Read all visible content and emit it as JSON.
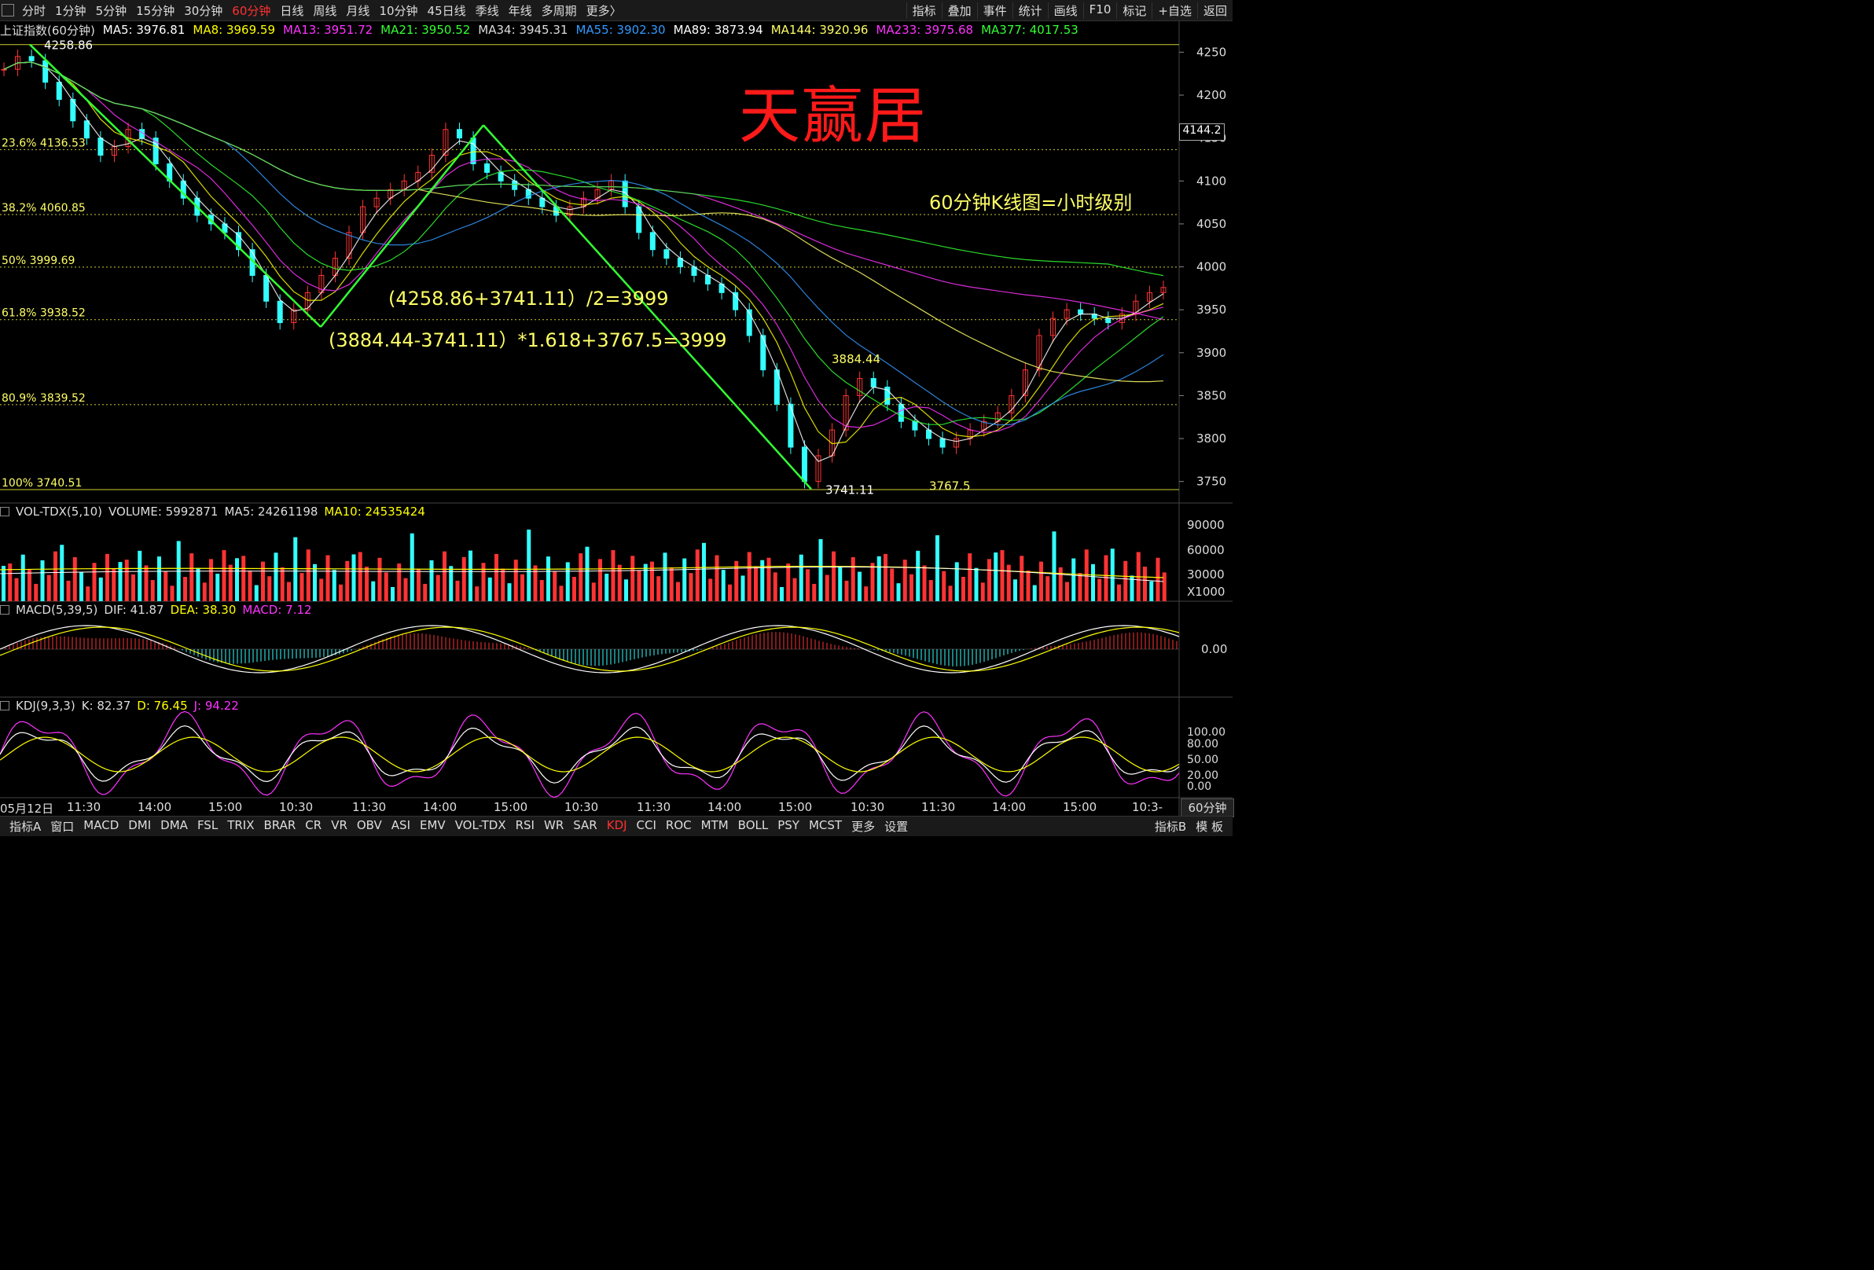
{
  "top_tabs": [
    "分时",
    "1分钟",
    "5分钟",
    "15分钟",
    "30分钟",
    "60分钟",
    "日线",
    "周线",
    "月线",
    "10分钟",
    "45日线",
    "季线",
    "年线",
    "多周期",
    "更多〉"
  ],
  "active_tab": "60分钟",
  "top_right": [
    "指标",
    "叠加",
    "事件",
    "统计",
    "画线",
    "F10",
    "标记",
    "+自选",
    "返回"
  ],
  "info": {
    "title": "上证指数(60分钟)",
    "ma": [
      {
        "label": "MA5: 3976.81",
        "color": "#ffffff"
      },
      {
        "label": "MA8: 3969.59",
        "color": "#ffff00"
      },
      {
        "label": "MA13: 3951.72",
        "color": "#ff33ff"
      },
      {
        "label": "MA21: 3950.52",
        "color": "#33ff33"
      },
      {
        "label": "MA34: 3945.31",
        "color": "#dddddd"
      },
      {
        "label": "MA55: 3902.30",
        "color": "#3399ff"
      },
      {
        "label": "MA89: 3873.94",
        "color": "#ffffff"
      },
      {
        "label": "MA144: 3920.96",
        "color": "#ffff66"
      },
      {
        "label": "MA233: 3975.68",
        "color": "#ff33ff"
      },
      {
        "label": "MA377: 4017.53",
        "color": "#33ff33"
      }
    ]
  },
  "watermark": "天赢居",
  "notes": {
    "hourly": "60分钟K线图=小时级别",
    "calc1": "(4258.86+3741.11）/2=3999",
    "calc2": "(3884.44-3741.11）*1.618+3767.5=3999"
  },
  "fib_levels": [
    {
      "label": "23.6% 4136.53",
      "value": 4136.53
    },
    {
      "label": "38.2% 4060.85",
      "value": 4060.85
    },
    {
      "label": "50% 3999.69",
      "value": 3999.69
    },
    {
      "label": "61.8% 3938.52",
      "value": 3938.52
    },
    {
      "label": "80.9% 3839.52",
      "value": 3839.52
    },
    {
      "label": "100% 3740.51",
      "value": 3740.51
    }
  ],
  "price_marks": {
    "high": "4258.86",
    "low": "3741.11",
    "rebound": "3884.44",
    "secondary_low": "3767.5"
  },
  "current_price_tag": "4144.2",
  "price_axis": [
    "4250",
    "4200",
    "4150",
    "4100",
    "4050",
    "4000",
    "3950",
    "3900",
    "3850",
    "3800",
    "3750"
  ],
  "volume_header": {
    "name": "VOL-TDX(5,10)",
    "volume": "VOLUME: 5992871",
    "ma5": "MA5: 24261198",
    "ma10": "MA10: 24535424"
  },
  "volume_axis": [
    "90000",
    "60000",
    "30000",
    "X1000"
  ],
  "macd_header": {
    "name": "MACD(5,39,5)",
    "dif": "DIF: 41.87",
    "dea": "DEA: 38.30",
    "macd": "MACD: 7.12"
  },
  "macd_axis": [
    "0.00"
  ],
  "kdj_header": {
    "name": "KDJ(9,3,3)",
    "k": "K: 82.37",
    "d": "D: 76.45",
    "j": "J: 94.22"
  },
  "kdj_axis": [
    "100.00",
    "80.00",
    "50.00",
    "20.00",
    "0.00"
  ],
  "time_axis": [
    "05月12日",
    "11:30",
    "14:00",
    "15:00",
    "10:30",
    "11:30",
    "14:00",
    "15:00",
    "10:30",
    "11:30",
    "14:00",
    "15:00",
    "10:30",
    "11:30",
    "14:00",
    "15:00",
    "10:3-"
  ],
  "timeframe_btn": "60分钟",
  "bottom_tabs": [
    "指标A",
    "窗口",
    "MACD",
    "DMI",
    "DMA",
    "FSL",
    "TRIX",
    "BRAR",
    "CR",
    "VR",
    "OBV",
    "ASI",
    "EMV",
    "VOL-TDX",
    "RSI",
    "WR",
    "SAR",
    "KDJ",
    "CCI",
    "ROC",
    "MTM",
    "BOLL",
    "PSY",
    "MCST",
    "更多",
    "设置"
  ],
  "active_bottom": "KDJ",
  "bottom_right": [
    "指标B",
    "模 板"
  ],
  "chart_data": {
    "type": "line",
    "title": "上证指数(60分钟)",
    "ylim": [
      3725,
      4265
    ],
    "zigzag_points": [
      {
        "label": "high",
        "y": 4258.86
      },
      {
        "label": "low1",
        "y": 3930
      },
      {
        "label": "high2",
        "y": 4165
      },
      {
        "label": "low",
        "y": 3741.11
      }
    ],
    "swing_values": {
      "high": 4258.86,
      "rebound": 3884.44,
      "low": 3741.11,
      "secondary_low": 3767.5,
      "target": 3999
    },
    "series": [
      {
        "values": [
          4230,
          4245,
          4240,
          4215,
          4195,
          4170,
          4150,
          4130,
          4140,
          4160,
          4150,
          4120,
          4100,
          4080,
          4060,
          4050,
          4040,
          4020,
          3990,
          3960,
          3935,
          3950,
          3970,
          3990,
          4010,
          4040,
          4070,
          4080,
          4090,
          4100,
          4110,
          4130,
          4160,
          4150,
          4120,
          4110,
          4100,
          4090,
          4080,
          4070,
          4060,
          4070,
          4080,
          4090,
          4100,
          4070,
          4040,
          4020,
          4010,
          4000,
          3990,
          3980,
          3970,
          3950,
          3920,
          3880,
          3840,
          3790,
          3750,
          3780,
          3810,
          3850,
          3870,
          3860,
          3840,
          3820,
          3810,
          3800,
          3790,
          3800,
          3810,
          3820,
          3830,
          3850,
          3880,
          3920,
          3940,
          3950,
          3945,
          3940,
          3935,
          3945,
          3960,
          3970,
          3976
        ]
      }
    ]
  }
}
